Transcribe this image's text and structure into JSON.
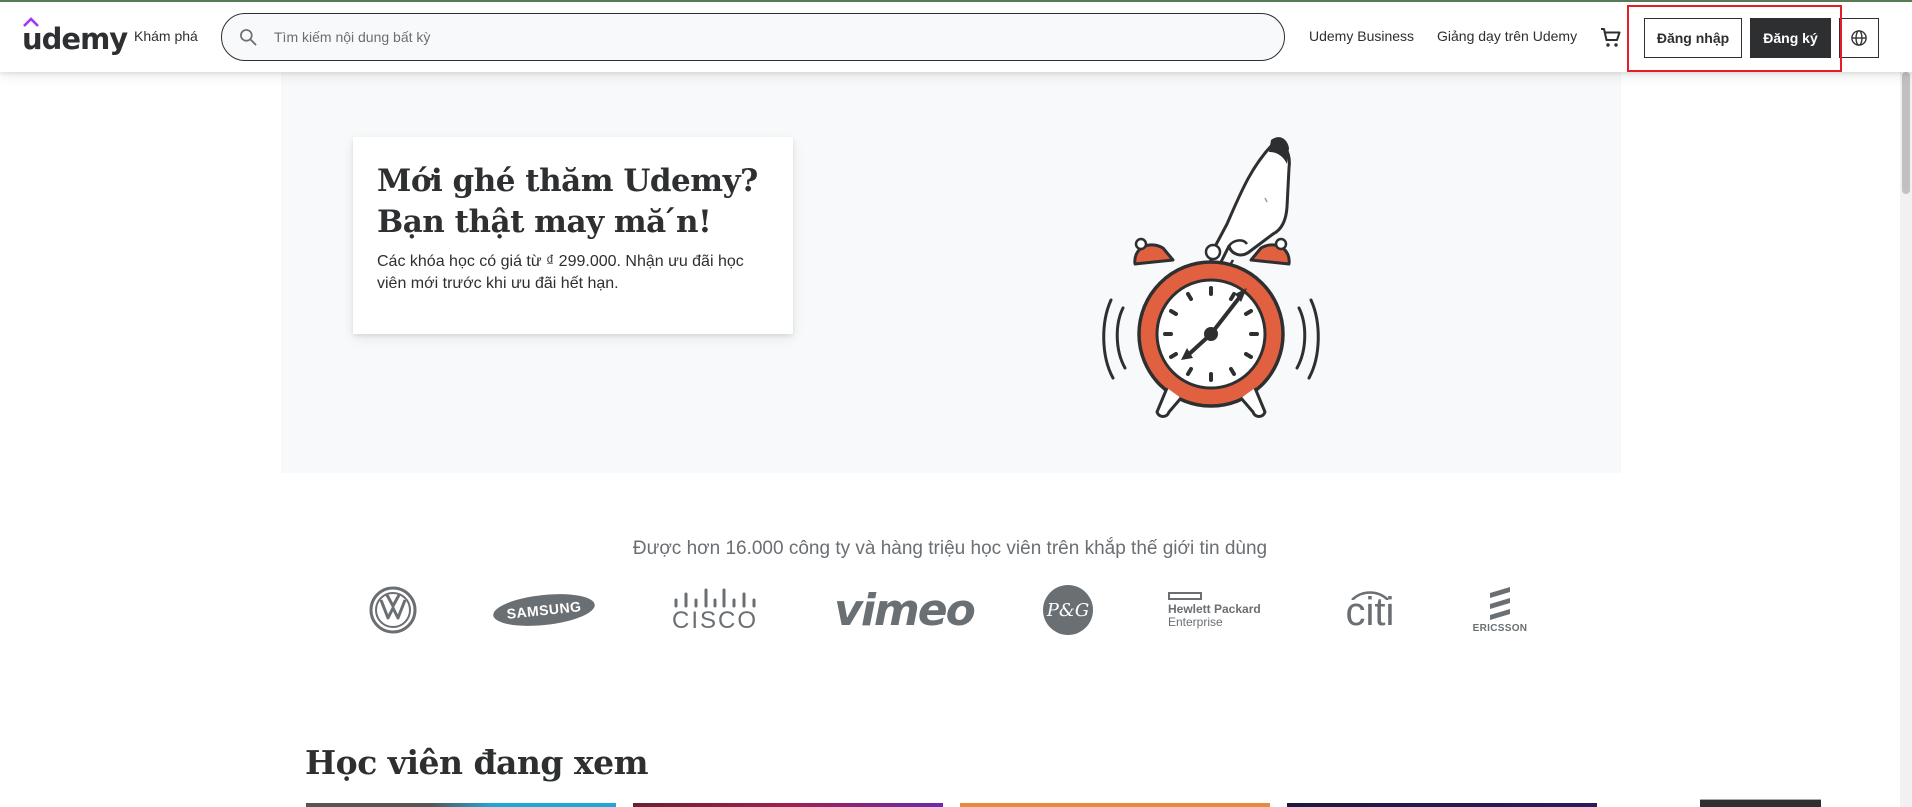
{
  "header": {
    "logo_text": "udemy",
    "explore_label": "Khám phá",
    "search_placeholder": "Tìm kiếm nội dung bất kỳ",
    "business_label": "Udemy Business",
    "teach_label": "Giảng dạy trên Udemy",
    "login_label": "Đăng nhập",
    "signup_label": "Đăng ký",
    "icons": [
      "search-icon",
      "cart-icon",
      "globe-icon"
    ]
  },
  "hero": {
    "title_line1": "Mới ghé thăm Udemy?",
    "title_line2": "Bạn thật may mă ́n!",
    "description": "Các khóa học có giá từ ₫ 299.000. Nhận ưu đãi học viên mới trước khi ưu đãi hết hạn."
  },
  "trust": {
    "text": "Được hơn 16.000 công ty và hàng triệu học viên trên khắp thế giới tin dùng",
    "brands": {
      "samsung": "SAMSUNG",
      "cisco": "CISCO",
      "vimeo": "vimeo",
      "pg": "P&G",
      "hpe_line1": "Hewlett Packard",
      "hpe_line2": "Enterprise",
      "citi": "citi",
      "ericsson": "ERICSSON"
    }
  },
  "section": {
    "title": "Học viên đang xem"
  },
  "colors": {
    "brand_purple": "#a435f0",
    "text_dark": "#2d2f31",
    "text_muted": "#6a6f73",
    "highlight_red": "#e41e26",
    "clock_orange": "#e0603f"
  }
}
